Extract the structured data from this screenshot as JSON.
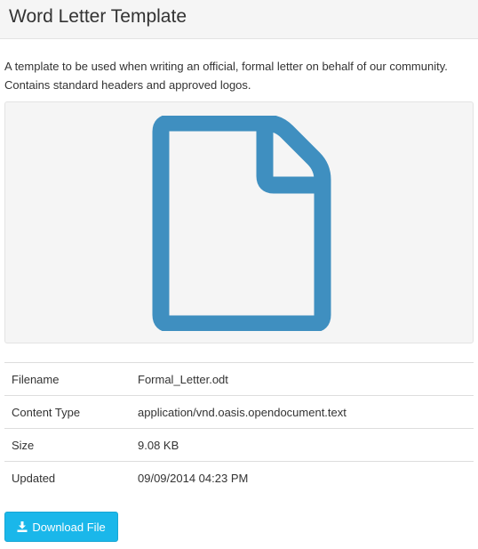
{
  "header": {
    "title": "Word Letter Template"
  },
  "description": "A template to be used when writing an official, formal letter on behalf of our community. Contains standard headers and approved logos.",
  "preview": {
    "icon": "file-icon",
    "icon_color": "#3f8fc0",
    "background_color": "#f5f5f5"
  },
  "details": [
    {
      "label": "Filename",
      "value": "Formal_Letter.odt"
    },
    {
      "label": "Content Type",
      "value": "application/vnd.oasis.opendocument.text"
    },
    {
      "label": "Size",
      "value": "9.08 KB"
    },
    {
      "label": "Updated",
      "value": "09/09/2014 04:23 PM"
    }
  ],
  "download": {
    "label": "Download File",
    "icon": "download-icon",
    "color": "#1ab7ea"
  }
}
